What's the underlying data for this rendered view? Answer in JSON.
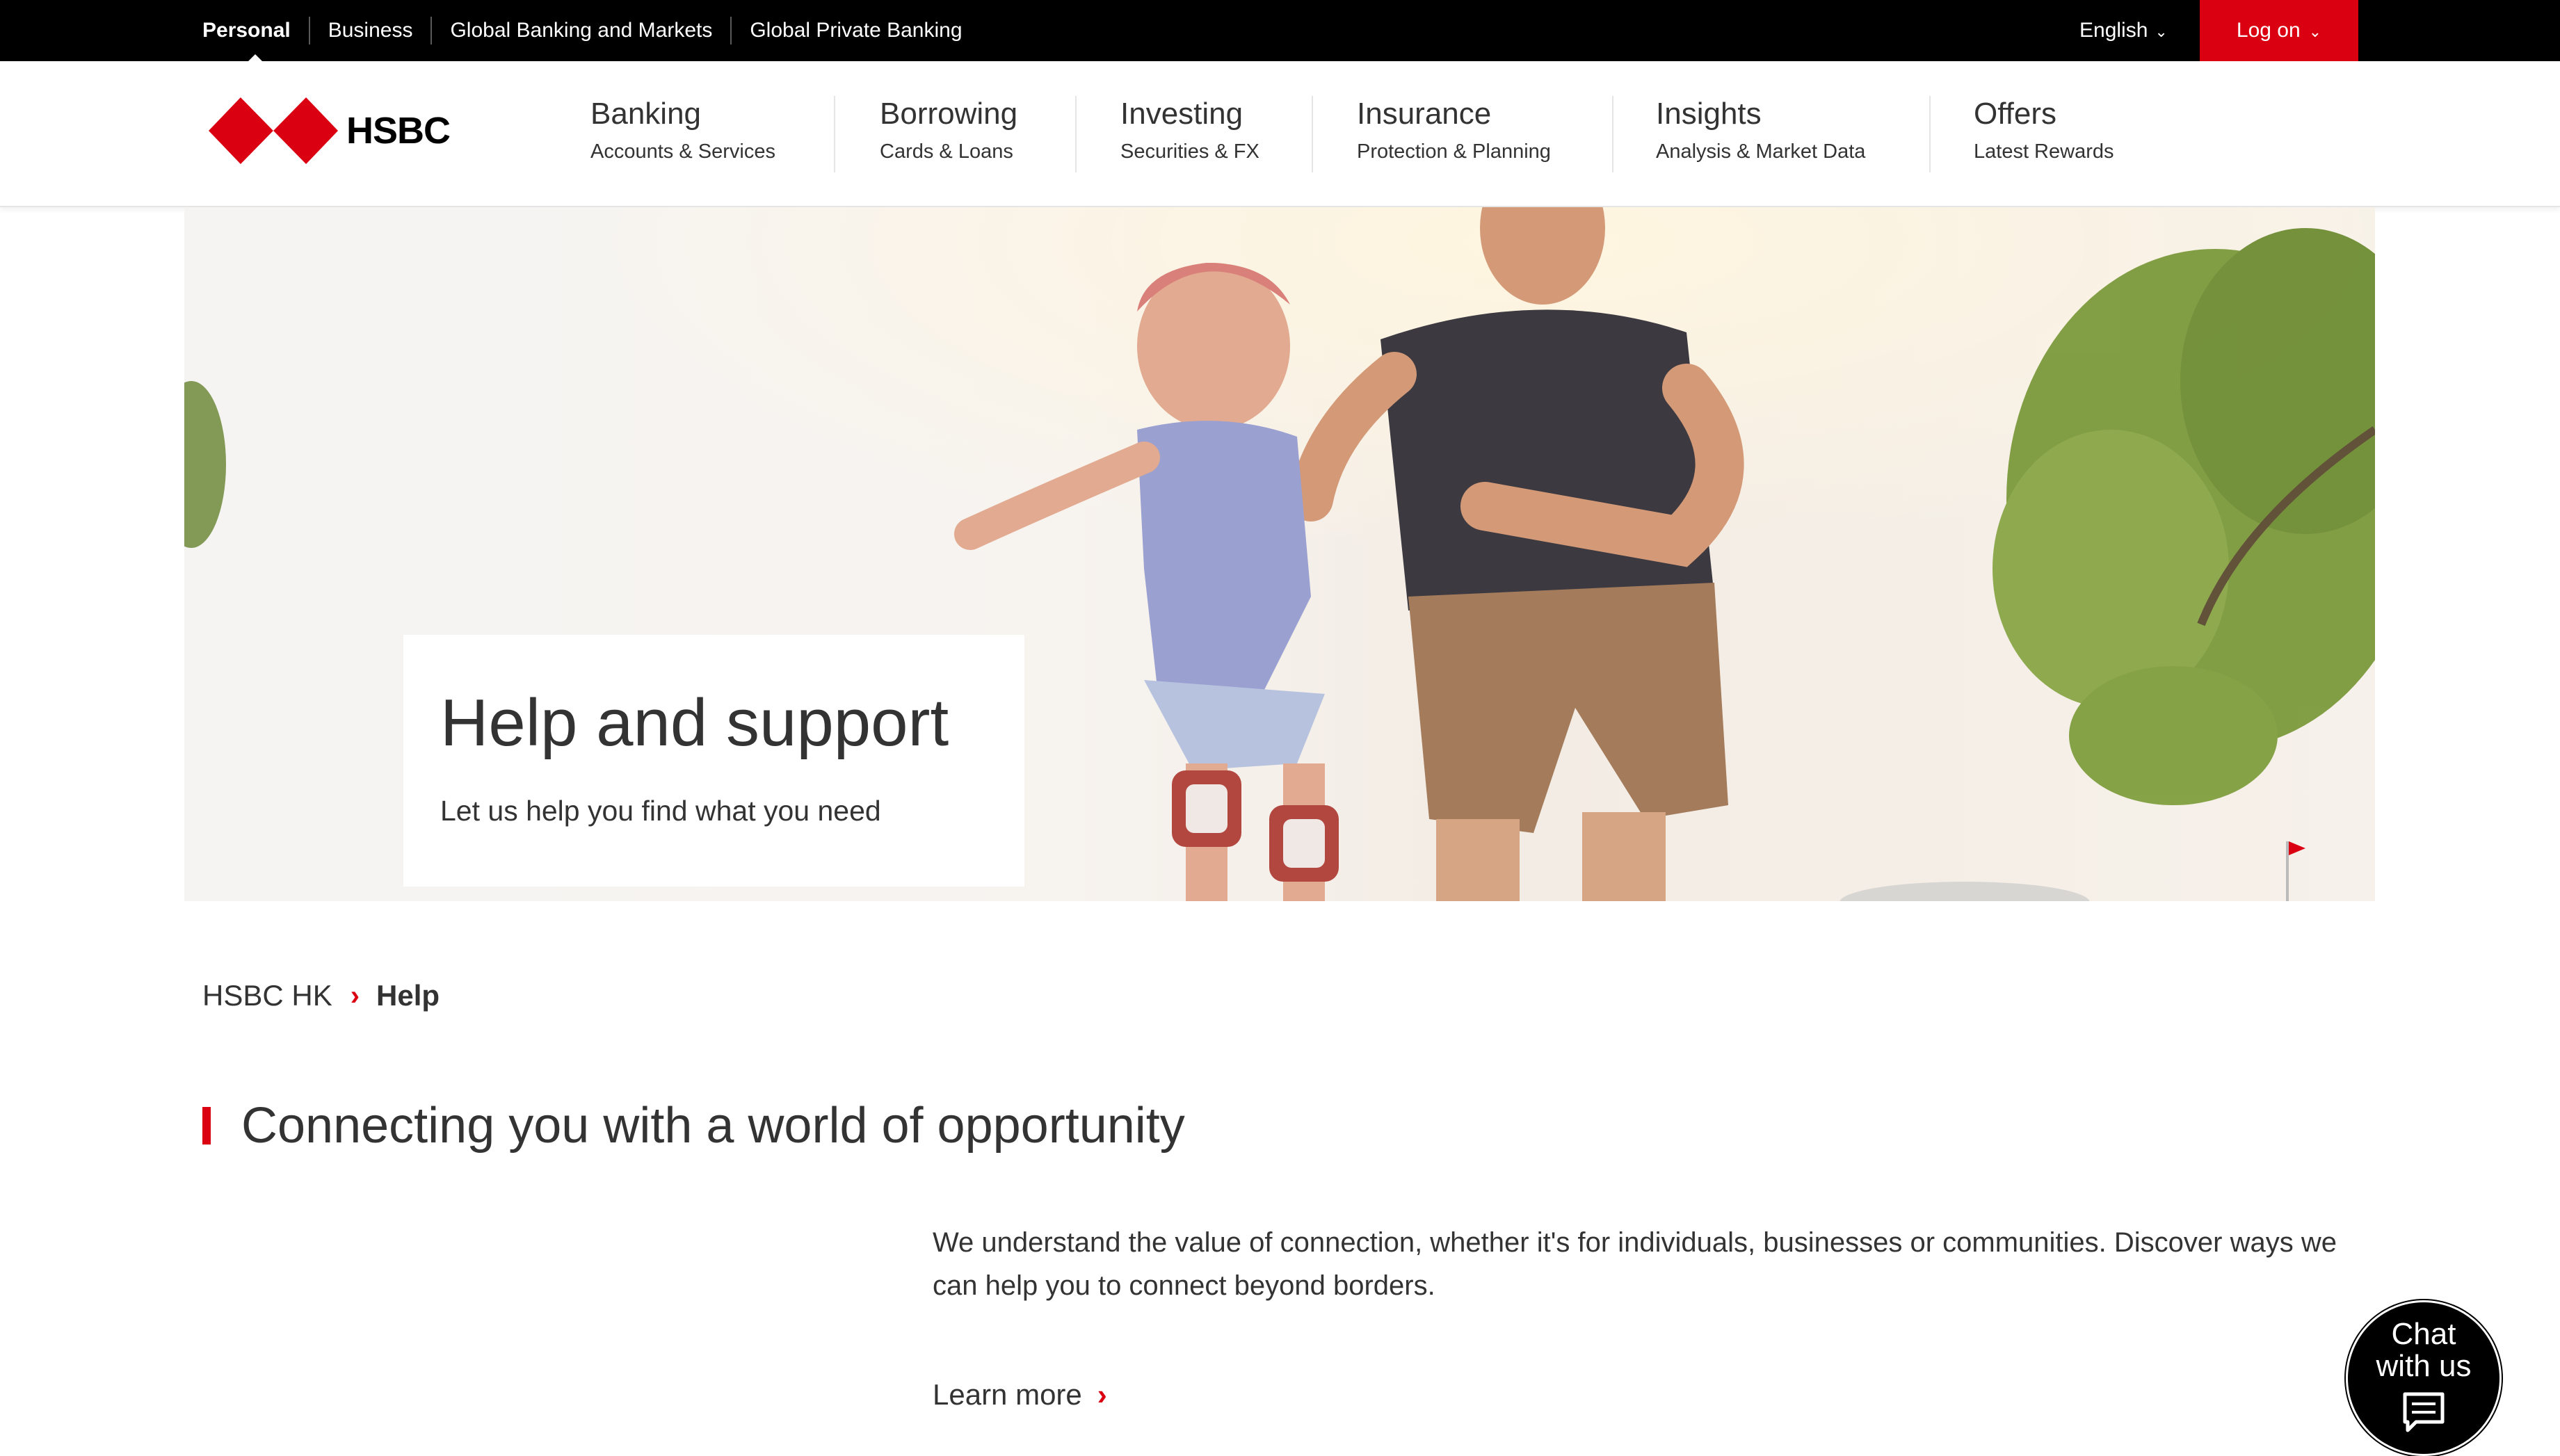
{
  "topbar": {
    "segments": [
      "Personal",
      "Business",
      "Global Banking and Markets",
      "Global Private Banking"
    ],
    "active_segment": "Personal",
    "language": "English",
    "logon_label": "Log on"
  },
  "brand": {
    "name": "HSBC",
    "primary_color": "#db0011"
  },
  "nav": {
    "items": [
      {
        "title": "Banking",
        "subtitle": "Accounts & Services"
      },
      {
        "title": "Borrowing",
        "subtitle": "Cards & Loans"
      },
      {
        "title": "Investing",
        "subtitle": "Securities & FX"
      },
      {
        "title": "Insurance",
        "subtitle": "Protection & Planning"
      },
      {
        "title": "Insights",
        "subtitle": "Analysis & Market Data"
      },
      {
        "title": "Offers",
        "subtitle": "Latest Rewards"
      }
    ]
  },
  "hero": {
    "title": "Help and support",
    "subtitle": "Let us help you find what you need"
  },
  "breadcrumb": {
    "home": "HSBC HK",
    "current": "Help"
  },
  "section": {
    "title": "Connecting you with a world of opportunity",
    "body": "We understand the value of connection, whether it's for individuals, businesses or communities. Discover ways we can help you to connect beyond borders.",
    "link": "Learn more"
  },
  "chat": {
    "line1": "Chat",
    "line2": "with us",
    "icon": "chat-bubble-icon"
  },
  "icons": {
    "chevron_down": "chevron-down-icon",
    "chevron_right": "chevron-right-icon"
  }
}
